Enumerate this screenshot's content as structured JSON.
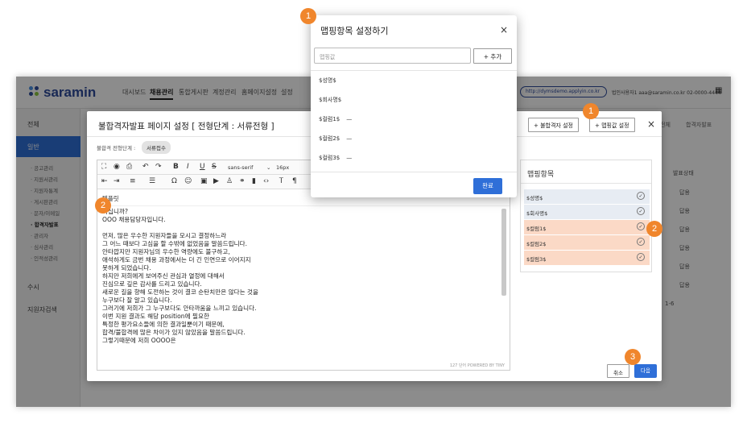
{
  "app": {
    "logo_text": "saramin",
    "nav": [
      "대시보드",
      "채용관리",
      "통합게시판",
      "계정관리",
      "홈페이지설정",
      "설정"
    ],
    "url": "http://dymsdemo.applyin.co.kr",
    "user_info": "법인사용자1 aaa@saramin.co.kr 02-0000-4444",
    "breadcrumb": [
      "전체",
      "합격자발표"
    ]
  },
  "sidebar": {
    "items": [
      "전체",
      "일반",
      "수시",
      "지원자검색"
    ],
    "sub_items": [
      "· 공고관리",
      "· 지원서관리",
      "· 지원자통계",
      "· 게시판관리",
      "· 문자/이메일",
      "· 합격자발표",
      "· 관리자",
      "· 심사관리",
      "· 인적성관리"
    ]
  },
  "right_table": {
    "header": "발표상태",
    "rows": [
      "답용",
      "답용",
      "답용",
      "답용",
      "답용",
      "답용"
    ],
    "pager": "1-6"
  },
  "modal": {
    "title": "불합격자발표 페이지 설정 [ 전형단계 : 서류전형 ]",
    "btn_set_fail": "+ 불합격자 설정",
    "btn_map_value": "+ 맵핑값 설정",
    "close": "×",
    "stage_label": "불합격 전형단계 :",
    "stage_chip": "서류접수",
    "font_name": "sans-serif",
    "font_size": "16px",
    "editor_title": "템플릿",
    "editor_lines": [
      "하십니까?",
      "OOO 채용담당자입니다.",
      "",
      "먼저, 많은 우수한 지원자들을 모시고 결정하느라",
      "그 어느 때보다 고심을 할 수밖에 없었음을 말씀드립니다.",
      "안타깝지만 지원자님의 우수한 역량에도 불구하고,",
      "애석하게도 금번 채용 과정에서는 더 긴 인연으로 이어지지",
      "못하게 되었습니다.",
      "하지만 저희에게 보여주신 관심과 열정에 대해서",
      "진심으로 깊은 감사를 드리고 있습니다.",
      "새로운 길을 향해 도전하는 것이 결코 순탄치만은 않다는 것을",
      "누구보다 잘 알고 있습니다.",
      "그러기에 저희가 그 누구보다도 안타까움을 느끼고 있습니다.",
      "이번 지원 결과도 해당 position에 필요한",
      "특정한 평가요소들에 의한 결과일뿐이기 때문에,",
      "합격/불합격에 많은 차이가 있지 않았음을 말씀드립니다.",
      "그렇기때문에 저희 OOOO은"
    ],
    "word_count": "127 단어  POWERED BY TINY",
    "mapping_title": "맵핑항목",
    "mapping_items": [
      {
        "label": "$성명$",
        "highlight": false
      },
      {
        "label": "$회사명$",
        "highlight": false
      },
      {
        "label": "$컬럼1$",
        "highlight": true
      },
      {
        "label": "$컬럼2$",
        "highlight": true
      },
      {
        "label": "$컬럼3$",
        "highlight": true
      }
    ],
    "cancel": "취소",
    "next": "다음"
  },
  "popup": {
    "title": "맵핑항목 설정하기",
    "close": "×",
    "input_placeholder": "맵핑값",
    "add_button": "+ 추가",
    "items": [
      {
        "label": "$성명$",
        "dash": ""
      },
      {
        "label": "$회사명$",
        "dash": ""
      },
      {
        "label": "$컬럼1$",
        "dash": "—"
      },
      {
        "label": "$컬럼2$",
        "dash": "—"
      },
      {
        "label": "$컬럼3$",
        "dash": "—"
      }
    ],
    "done": "완료"
  },
  "badges": [
    "1",
    "1",
    "2",
    "2",
    "3"
  ],
  "colors": {
    "accent": "#2f6fd8",
    "badge": "#f0862c",
    "highlight_item": "#fbd9c6",
    "normal_item": "#e7ecf3"
  }
}
